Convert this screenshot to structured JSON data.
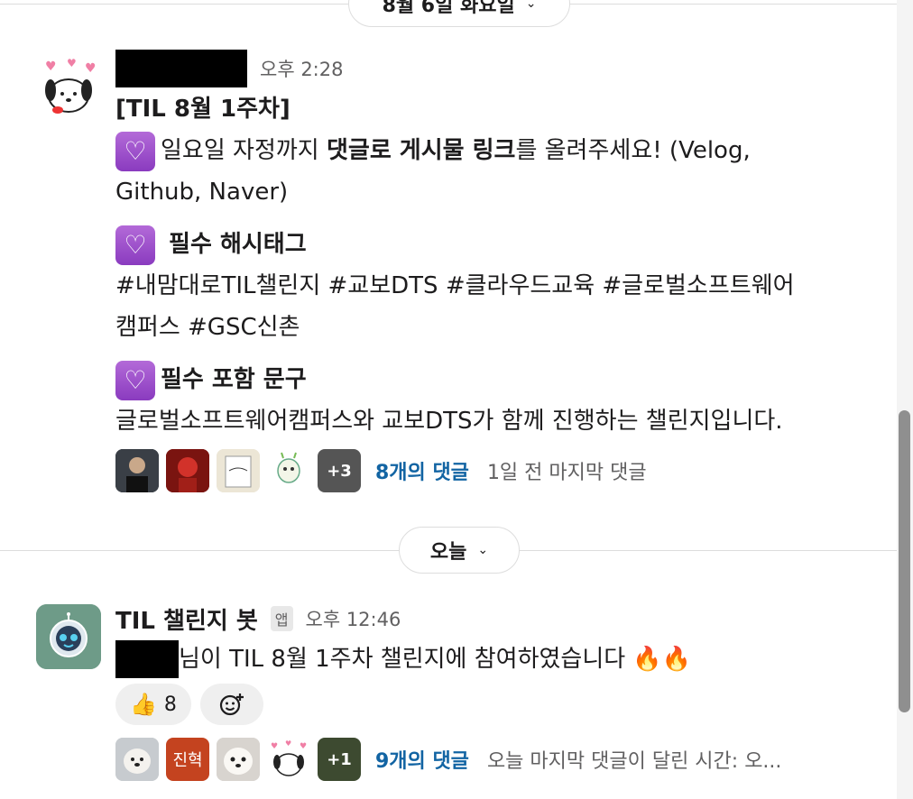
{
  "date_dividers": [
    {
      "label": "8월 6일 화요일"
    },
    {
      "label": "오늘"
    }
  ],
  "message1": {
    "time": "오후 2:28",
    "title": "[TIL 8월 1주차]",
    "line1_pre": "일요일 자정까지 ",
    "line1_bold": "댓글로 게시물 링크",
    "line1_post": "를 올려주세요! (Velog,",
    "line1_cont": "Github, Naver)",
    "section2_title": " 필수 해시태그",
    "hashtags_line1": "#내맘대로TIL챌린지 #교보DTS #클라우드교육 #글로벌소프트웨어",
    "hashtags_line2": "캠퍼스 #GSC신촌",
    "section3_title": "필수 포함 문구",
    "phrase": "글로벌소프트웨어캠퍼스와 교보DTS가 함께 진행하는 챌린지입니다.",
    "thread": {
      "more": "+3",
      "reply_count": "8개의 댓글",
      "last_reply": "1일 전 마지막 댓글"
    }
  },
  "message2": {
    "sender": "TIL 챌린지 봇",
    "app_badge": "앱",
    "time": "오후 12:46",
    "text": "님이 TIL 8월 1주차 챌린지에 참여하였습니다 🔥🔥",
    "reaction_thumbs_count": "8",
    "thread": {
      "avatar_text": "진혁",
      "more": "+1",
      "reply_count": "9개의 댓글",
      "last_reply": "오늘 마지막 댓글이 달린 시간: 오..."
    }
  },
  "colors": {
    "link": "#1264a3",
    "heart_purple": "#9b4fce",
    "muted": "#616061"
  }
}
